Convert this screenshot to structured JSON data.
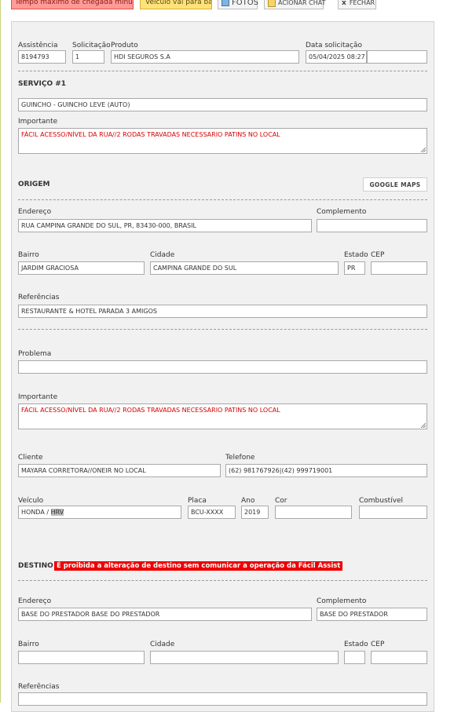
{
  "toolbar": {
    "tempo_label": "Tempo máximo de chegada minuto(s)",
    "veiculo_base_label": "Veículo vai para base",
    "fotos_label": "FOTOS",
    "chat_label": "ACIONAR CHAT",
    "fechar_label": "FECHAR"
  },
  "header": {
    "assistencia_label": "Assistência",
    "assistencia_value": "8194793",
    "solicitacao_label": "Solicitação",
    "solicitacao_value": "1",
    "produto_label": "Produto",
    "produto_value": "HDI SEGUROS S.A",
    "data_label": "Data solicitação",
    "data_value": "05/04/2025 08:27",
    "extra_value": ""
  },
  "servico": {
    "title": "SERVIÇO #1",
    "tipo_value": "GUINCHO - GUINCHO LEVE (AUTO)",
    "importante_label": "Importante",
    "importante_value": "FÁCIL ACESSO/NÍVEL DA RUA//2 RODAS TRAVADAS NECESSARIO PATINS NO LOCAL"
  },
  "origem": {
    "title": "ORIGEM",
    "gmaps_label": "GOOGLE MAPS",
    "endereco_label": "Endereço",
    "endereco_value": "RUA CAMPINA GRANDE DO SUL, PR, 83430-000, BRASIL",
    "complemento_label": "Complemento",
    "complemento_value": "",
    "bairro_label": "Bairro",
    "bairro_value": "JARDIM GRACIOSA",
    "cidade_label": "Cidade",
    "cidade_value": "CAMPINA GRANDE DO SUL",
    "estado_label": "Estado",
    "estado_value": "PR",
    "cep_label": "CEP",
    "cep_value": "",
    "referencias_label": "Referências",
    "referencias_value": "RESTAURANTE & HOTEL PARADA 3 AMIGOS"
  },
  "detalhes": {
    "problema_label": "Problema",
    "problema_value": "",
    "importante_label": "Importante",
    "importante_value": "FÁCIL ACESSO/NÍVEL DA RUA//2 RODAS TRAVADAS NECESSARIO PATINS NO LOCAL",
    "cliente_label": "Cliente",
    "cliente_value": "MAYARA CORRETORA//ONEIR NO LOCAL",
    "telefone_label": "Telefone",
    "telefone_value": "(62) 981767926|(42) 999719001",
    "veiculo_label": "Veículo",
    "veiculo_prefix": "HONDA / ",
    "veiculo_highlight": "HRV",
    "placa_label": "Placa",
    "placa_value": "BCU-XXXX",
    "ano_label": "Ano",
    "ano_value": "2019",
    "cor_label": "Cor",
    "cor_value": "",
    "combustivel_label": "Combustível",
    "combustivel_value": ""
  },
  "destino": {
    "title": "DESTINO",
    "warning": "É proibida a alteração de destino sem comunicar a operação da Fácil Assist",
    "endereco_label": "Endereço",
    "endereco_value": "BASE DO PRESTADOR BASE DO PRESTADOR",
    "complemento_label": "Complemento",
    "complemento_value": "BASE DO PRESTADOR",
    "bairro_label": "Bairro",
    "bairro_value": "",
    "cidade_label": "Cidade",
    "cidade_value": "",
    "estado_label": "Estado",
    "estado_value": "",
    "cep_label": "CEP",
    "cep_value": "",
    "referencias_label": "Referências",
    "referencias_value": ""
  }
}
